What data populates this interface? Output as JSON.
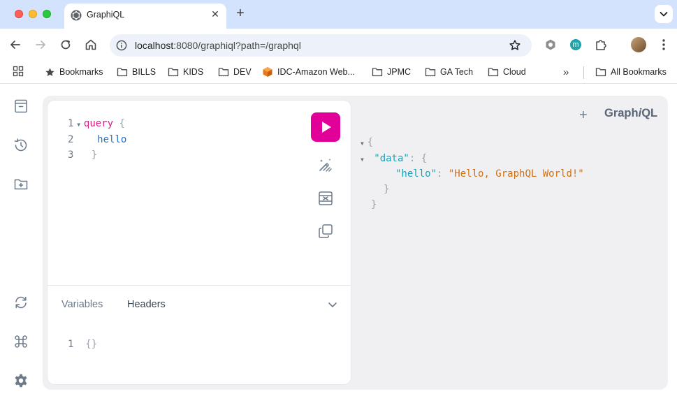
{
  "browser": {
    "tab": {
      "title": "GraphiQL",
      "close": "✕"
    },
    "new_tab": "+",
    "omnibox": {
      "url_host": "localhost",
      "url_rest": ":8080/graphiql?path=/graphql"
    },
    "extensions": {
      "m_label": "m"
    },
    "bookmarks": [
      {
        "label": "Bookmarks",
        "icon": "star-icon"
      },
      {
        "label": "BILLS",
        "icon": "folder-icon"
      },
      {
        "label": "KIDS",
        "icon": "folder-icon"
      },
      {
        "label": "DEV",
        "icon": "folder-icon"
      },
      {
        "label": "IDC-Amazon Web...",
        "icon": "aws-icon"
      },
      {
        "label": "JPMC",
        "icon": "folder-icon"
      },
      {
        "label": "GA Tech",
        "icon": "folder-icon"
      },
      {
        "label": "Cloud",
        "icon": "folder-icon"
      }
    ],
    "bookmarks_overflow": "»",
    "all_bookmarks": "All Bookmarks"
  },
  "graphiql": {
    "brand_prefix": "Graph",
    "brand_i": "i",
    "brand_suffix": "QL",
    "add_tab": "+",
    "query_lines": [
      {
        "num": "1",
        "keyword": "query",
        "punct": " {"
      },
      {
        "num": "2",
        "field": "hello"
      },
      {
        "num": "3",
        "punct": "}"
      }
    ],
    "bottom_tabs": {
      "variables": "Variables",
      "headers": "Headers"
    },
    "variables_editor": {
      "num": "1",
      "value": "{}"
    },
    "result": {
      "open": "{",
      "data_key": "\"data\"",
      "data_open": ": {",
      "hello_key": "\"hello\"",
      "hello_value": "\"Hello, GraphQL World!\"",
      "inner_close": "}",
      "outer_close": "}"
    }
  },
  "colors": {
    "accent_run": "#e10098",
    "keyword": "#d81b83",
    "field": "#1e73cf",
    "json_key": "#1aa2b7",
    "json_string": "#d2700f"
  }
}
